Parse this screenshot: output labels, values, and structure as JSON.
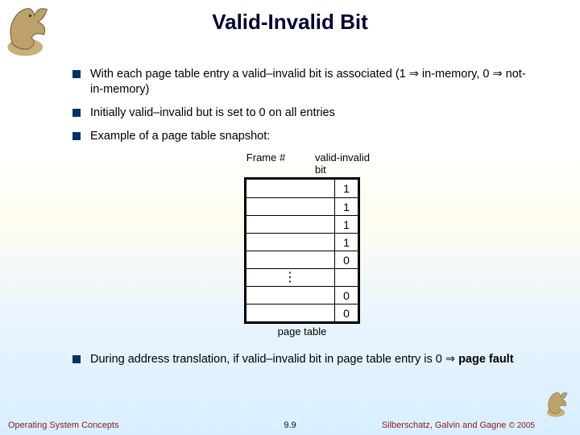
{
  "title": "Valid-Invalid Bit",
  "bullets": {
    "b0": "With each page table entry a valid–invalid bit is associated (1 ⇒ in-memory, 0 ⇒ not-in-memory)",
    "b1": "Initially valid–invalid but is set to 0 on all entries",
    "b2": "Example of a page table snapshot:",
    "b3_pre": "During address translation, if valid–invalid bit in page table entry is 0 ⇒ ",
    "b3_strong": "page fault"
  },
  "table": {
    "header_frame": "Frame #",
    "header_vib": "valid-invalid bit",
    "caption": "page table",
    "rows": [
      {
        "frame": "",
        "bit": "1"
      },
      {
        "frame": "",
        "bit": "1"
      },
      {
        "frame": "",
        "bit": "1"
      },
      {
        "frame": "",
        "bit": "1"
      },
      {
        "frame": "",
        "bit": "0"
      },
      {
        "frame": "",
        "bit": ""
      },
      {
        "frame": "",
        "bit": "0"
      },
      {
        "frame": "",
        "bit": "0"
      }
    ],
    "dots": "⋮"
  },
  "footer": {
    "left": "Operating System Concepts",
    "center": "9.9",
    "right": "Silberschatz, Galvin and Gagne ",
    "copy": "© 2005"
  }
}
